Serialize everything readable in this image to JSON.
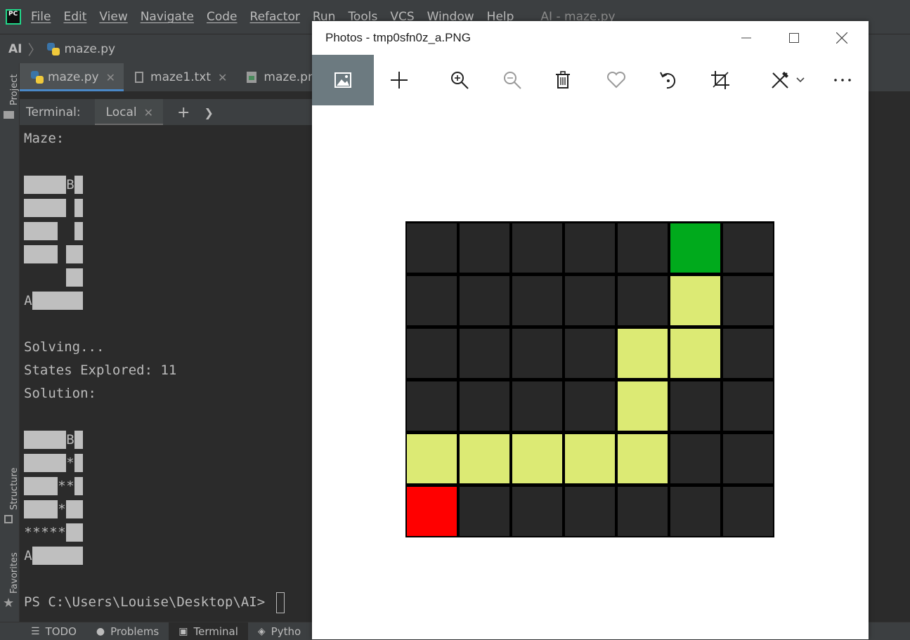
{
  "ide": {
    "menu": [
      "File",
      "Edit",
      "View",
      "Navigate",
      "Code",
      "Refactor",
      "Run",
      "Tools",
      "VCS",
      "Window",
      "Help"
    ],
    "window_title": "AI - maze.py",
    "breadcrumb": {
      "root": "AI",
      "file": "maze.py"
    },
    "sidebar": {
      "project": "Project",
      "structure": "Structure",
      "favorites": "Favorites"
    },
    "tabs": [
      {
        "label": "maze.py",
        "icon": "python-file-icon",
        "active": true
      },
      {
        "label": "maze1.txt",
        "icon": "text-file-icon",
        "active": false
      },
      {
        "label": "maze.png",
        "icon": "image-file-icon",
        "active": false
      }
    ],
    "terminal": {
      "title": "Terminal:",
      "tab": "Local",
      "lines": {
        "maze_header": "Maze:",
        "solving": "Solving...",
        "states": "States Explored: 11",
        "solution": "Solution:",
        "prompt": "PS C:\\Users\\Louise\\Desktop\\AI> "
      },
      "maze_rows": [
        "█████B█",
        "█████ █",
        "████  █",
        "████ ██",
        "     ██",
        "A██████"
      ],
      "solution_rows": [
        "█████B█",
        "█████*█",
        "████**█",
        "████*██",
        "*****██",
        "A██████"
      ]
    },
    "statusbar": [
      {
        "label": "TODO",
        "icon": "todo-list-icon"
      },
      {
        "label": "Problems",
        "icon": "problems-icon"
      },
      {
        "label": "Terminal",
        "icon": "terminal-icon"
      },
      {
        "label": "Pytho",
        "icon": "python-console-icon"
      }
    ]
  },
  "photos": {
    "title": "Photos - tmp0sfn0z_a.PNG",
    "toolbar": [
      "image-view-icon",
      "add-icon",
      "zoom-in-icon",
      "zoom-out-icon",
      "delete-icon",
      "favorite-icon",
      "rotate-icon",
      "crop-icon",
      "edit-icon",
      "more-icon"
    ],
    "colors": {
      "wall": "#282828",
      "path": "#dcea74",
      "start": "#ff0000",
      "goal": "#00aa1c",
      "grid": "#000000"
    },
    "grid": [
      [
        "wall",
        "wall",
        "wall",
        "wall",
        "wall",
        "goal",
        "wall"
      ],
      [
        "wall",
        "wall",
        "wall",
        "wall",
        "wall",
        "path",
        "wall"
      ],
      [
        "wall",
        "wall",
        "wall",
        "wall",
        "path",
        "path",
        "wall"
      ],
      [
        "wall",
        "wall",
        "wall",
        "wall",
        "path",
        "wall",
        "wall"
      ],
      [
        "path",
        "path",
        "path",
        "path",
        "path",
        "wall",
        "wall"
      ],
      [
        "start",
        "wall",
        "wall",
        "wall",
        "wall",
        "wall",
        "wall"
      ]
    ]
  }
}
